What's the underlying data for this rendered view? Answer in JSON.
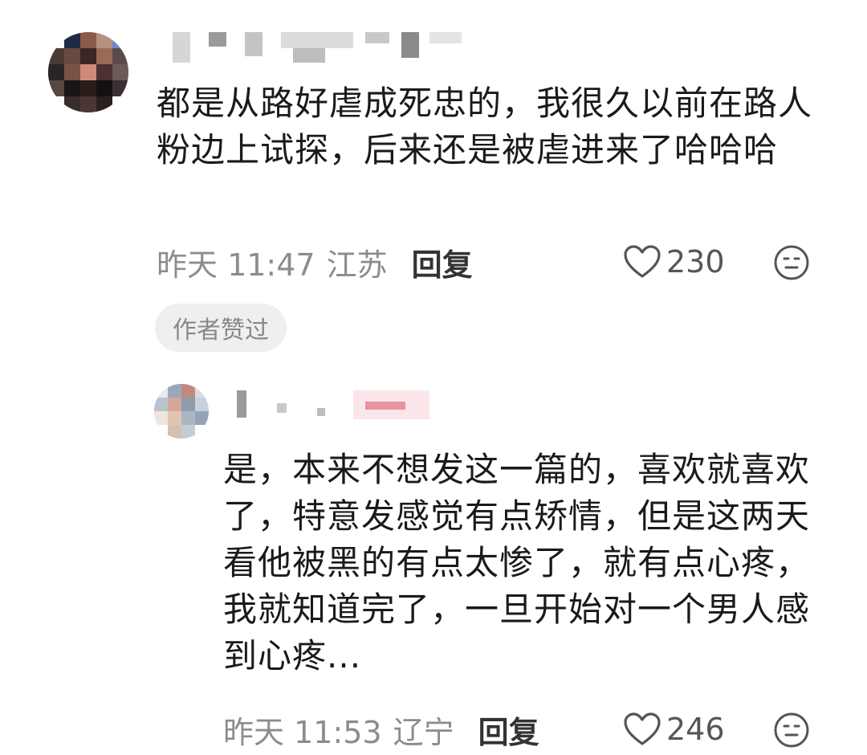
{
  "comments": [
    {
      "text": "都是从路好虐成死忠的，我很久以前在路人粉边上试探，后来还是被虐进来了哈哈哈",
      "time": "昨天 11:47",
      "location": "江苏",
      "reply_label": "回复",
      "likes": "230",
      "badge": "作者赞过"
    },
    {
      "text": "是，本来不想发这一篇的，喜欢就喜欢了，特意发感觉有点矫情，但是这两天看他被黑的有点太惨了，就有点心疼，我就知道完了，一旦开始对一个男人感到心疼...",
      "time": "昨天 11:53",
      "location": "辽宁",
      "reply_label": "回复",
      "likes": "246"
    }
  ],
  "icons": {
    "like": "heart-outline-icon",
    "reaction": "neutral-face-icon"
  },
  "colors": {
    "meta_text": "#8c8c8c",
    "badge_bg": "#efefef"
  }
}
